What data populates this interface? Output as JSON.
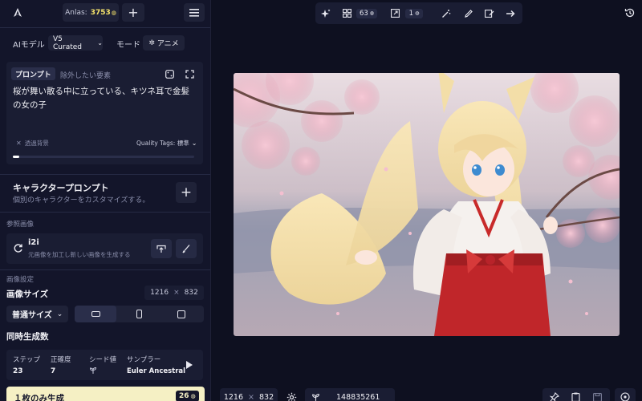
{
  "header": {
    "anlas_label": "Anlas:",
    "anlas_value": "3753"
  },
  "model": {
    "label": "AIモデル",
    "value": "V5 Curated",
    "mode_label": "モード",
    "mode_value": "アニメ"
  },
  "prompt": {
    "tab_prompt": "プロンプト",
    "tab_exclude": "除外したい要素",
    "text": "桜が舞い散る中に立っている、キツネ耳で金髪の女の子",
    "transparent_bg": "透過背景",
    "quality_tags": "Quality Tags: 標準"
  },
  "character": {
    "title": "キャラクタープロンプト",
    "desc": "個別のキャラクターをカスタマイズする。"
  },
  "reference": {
    "section": "参照画像",
    "i2i_title": "i2i",
    "i2i_desc": "元画像を加工し新しい画像を生成する"
  },
  "image_settings": {
    "section": "画像設定",
    "size_label": "画像サイズ",
    "width": "1216",
    "times": "×",
    "height": "832",
    "size_preset": "普通サイズ",
    "batch_label": "同時生成数"
  },
  "params": {
    "steps_label": "ステップ",
    "steps_value": "23",
    "guidance_label": "正確度",
    "guidance_value": "7",
    "seed_label": "シード値",
    "sampler_label": "サンプラー",
    "sampler_value": "Euler Ancestral"
  },
  "generate": {
    "label": "１枚のみ生成",
    "cost": "26"
  },
  "toolbar": {
    "count_value": "63",
    "batch_value": "1"
  },
  "bottom": {
    "width": "1216",
    "times": "×",
    "height": "832",
    "seed": "148835261"
  },
  "colors": {
    "background": "#0e1020",
    "panel": "#13152a",
    "card": "#1a1d33",
    "generate_bg": "#f5f0c4",
    "accent_yellow": "#f5e36b"
  }
}
